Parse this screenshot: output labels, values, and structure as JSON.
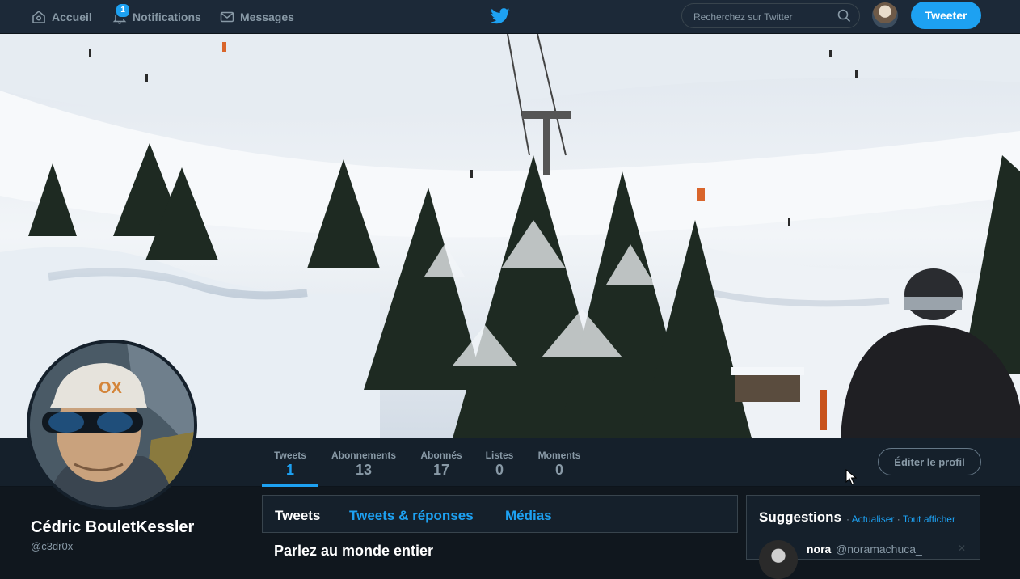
{
  "nav": {
    "home_label": "Accueil",
    "notifications_label": "Notifications",
    "notifications_badge": "1",
    "messages_label": "Messages",
    "search_placeholder": "Recherchez sur Twitter",
    "tweet_button": "Tweeter"
  },
  "profile": {
    "name": "Cédric BouletKessler",
    "handle": "@c3dr0x",
    "stats": [
      {
        "label": "Tweets",
        "value": "1"
      },
      {
        "label": "Abonnements",
        "value": "13"
      },
      {
        "label": "Abonnés",
        "value": "17"
      },
      {
        "label": "Listes",
        "value": "0"
      },
      {
        "label": "Moments",
        "value": "0"
      }
    ],
    "edit_button": "Éditer le profil"
  },
  "timeline": {
    "tabs": [
      "Tweets",
      "Tweets & réponses",
      "Médias"
    ],
    "active_tab": "Tweets",
    "headline": "Parlez au monde entier"
  },
  "suggestions": {
    "title": "Suggestions",
    "refresh_label": "Actualiser",
    "show_all_label": "Tout afficher",
    "separator": "·",
    "user": {
      "name": "nora",
      "handle": "@noramachuca_"
    }
  },
  "colors": {
    "accent": "#1da1f2",
    "background": "#10171e",
    "nav_background": "#1c2938"
  }
}
